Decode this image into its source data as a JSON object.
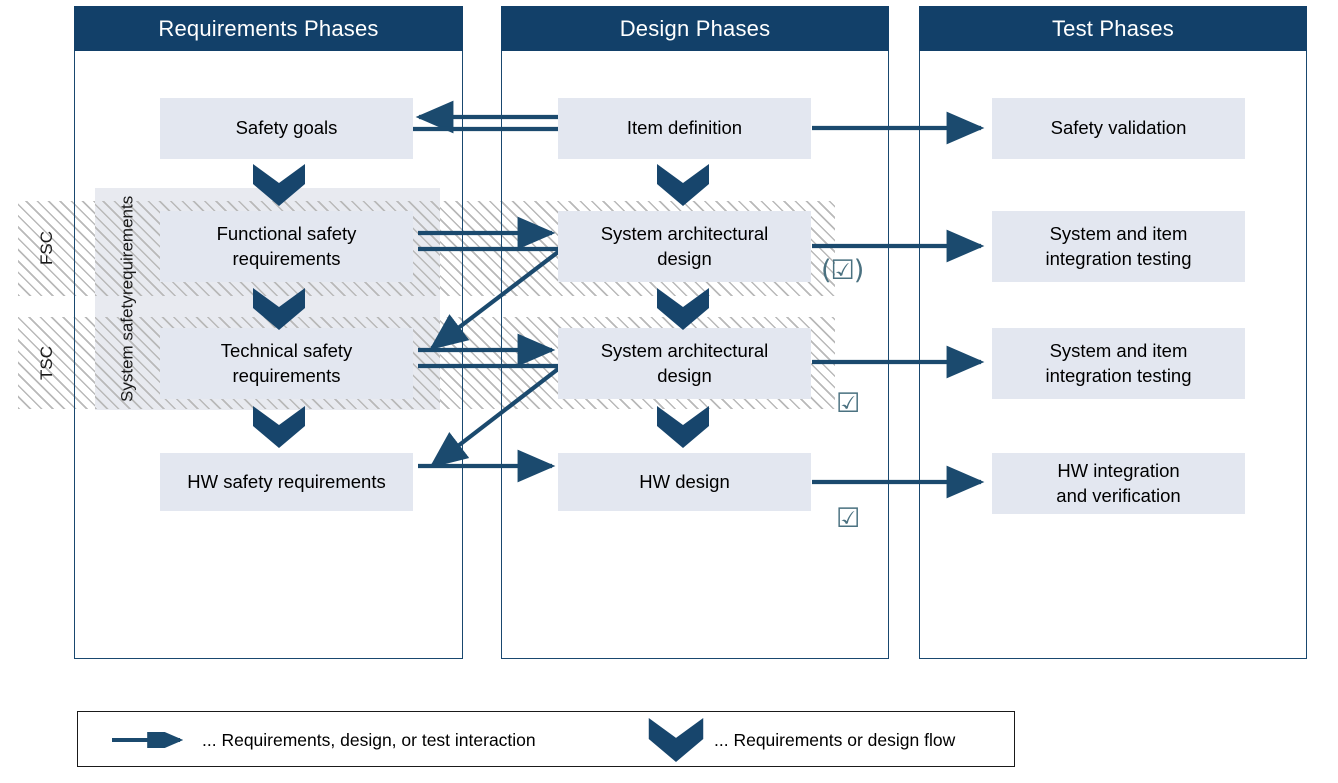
{
  "diagram": {
    "title": "ISO 26262 Requirements / Design / Test phase interaction",
    "colors": {
      "header_bg": "#124069",
      "header_text": "#ffffff",
      "frame_border": "#19486f",
      "box_fill": "#e3e7f0",
      "panel_fill": "#e8eaf0",
      "arrow": "#1b4a6e",
      "chevron": "#17456c",
      "checkbox": "#4a7180",
      "hatch_line": "#b9b9b9"
    }
  },
  "columns": [
    {
      "id": "requirements",
      "header": "Requirements Phases"
    },
    {
      "id": "design",
      "header": "Design Phases"
    },
    {
      "id": "test",
      "header": "Test Phases"
    }
  ],
  "side_bands": [
    {
      "id": "fsc",
      "label": "FSC"
    },
    {
      "id": "tsc",
      "label": "TSC"
    }
  ],
  "side_panel": {
    "label": "System safety\nrequirements",
    "line1": "System safety",
    "line2": "requirements"
  },
  "boxes": {
    "requirements": [
      {
        "id": "safety-goals",
        "label": "Safety goals"
      },
      {
        "id": "functional-safety-req",
        "label": "Functional safety\nrequirements",
        "line1": "Functional safety",
        "line2": "requirements"
      },
      {
        "id": "technical-safety-req",
        "label": "Technical safety\nrequirements",
        "line1": "Technical safety",
        "line2": "requirements"
      },
      {
        "id": "hw-safety-req",
        "label": "HW safety requirements"
      }
    ],
    "design": [
      {
        "id": "item-definition",
        "label": "Item definition"
      },
      {
        "id": "sys-arch-design-1",
        "label": "System architectural\ndesign",
        "line1": "System architectural",
        "line2": "design"
      },
      {
        "id": "sys-arch-design-2",
        "label": "System architectural\ndesign",
        "line1": "System architectural",
        "line2": "design"
      },
      {
        "id": "hw-design",
        "label": "HW design"
      }
    ],
    "test": [
      {
        "id": "safety-validation",
        "label": "Safety validation"
      },
      {
        "id": "sys-item-int-testing-1",
        "label": "System and item\nintegration testing",
        "line1": "System and item",
        "line2": "integration testing"
      },
      {
        "id": "sys-item-int-testing-2",
        "label": "System and item\nintegration testing",
        "line1": "System and item",
        "line2": "integration testing"
      },
      {
        "id": "hw-int-verification",
        "label": "HW integration\nand verification",
        "line1": "HW integration",
        "line2": "and verification"
      }
    ]
  },
  "checkmarks": [
    {
      "id": "check-optional-fsc",
      "glyph": "(☑)",
      "optional": true
    },
    {
      "id": "check-tsc",
      "glyph": "☑",
      "optional": false
    },
    {
      "id": "check-hw",
      "glyph": "☑",
      "optional": false
    }
  ],
  "legend": {
    "items": [
      {
        "id": "interaction",
        "symbol": "arrow",
        "text": "... Requirements, design, or test interaction"
      },
      {
        "id": "flow",
        "symbol": "chevron",
        "text": "... Requirements or design flow"
      }
    ]
  }
}
